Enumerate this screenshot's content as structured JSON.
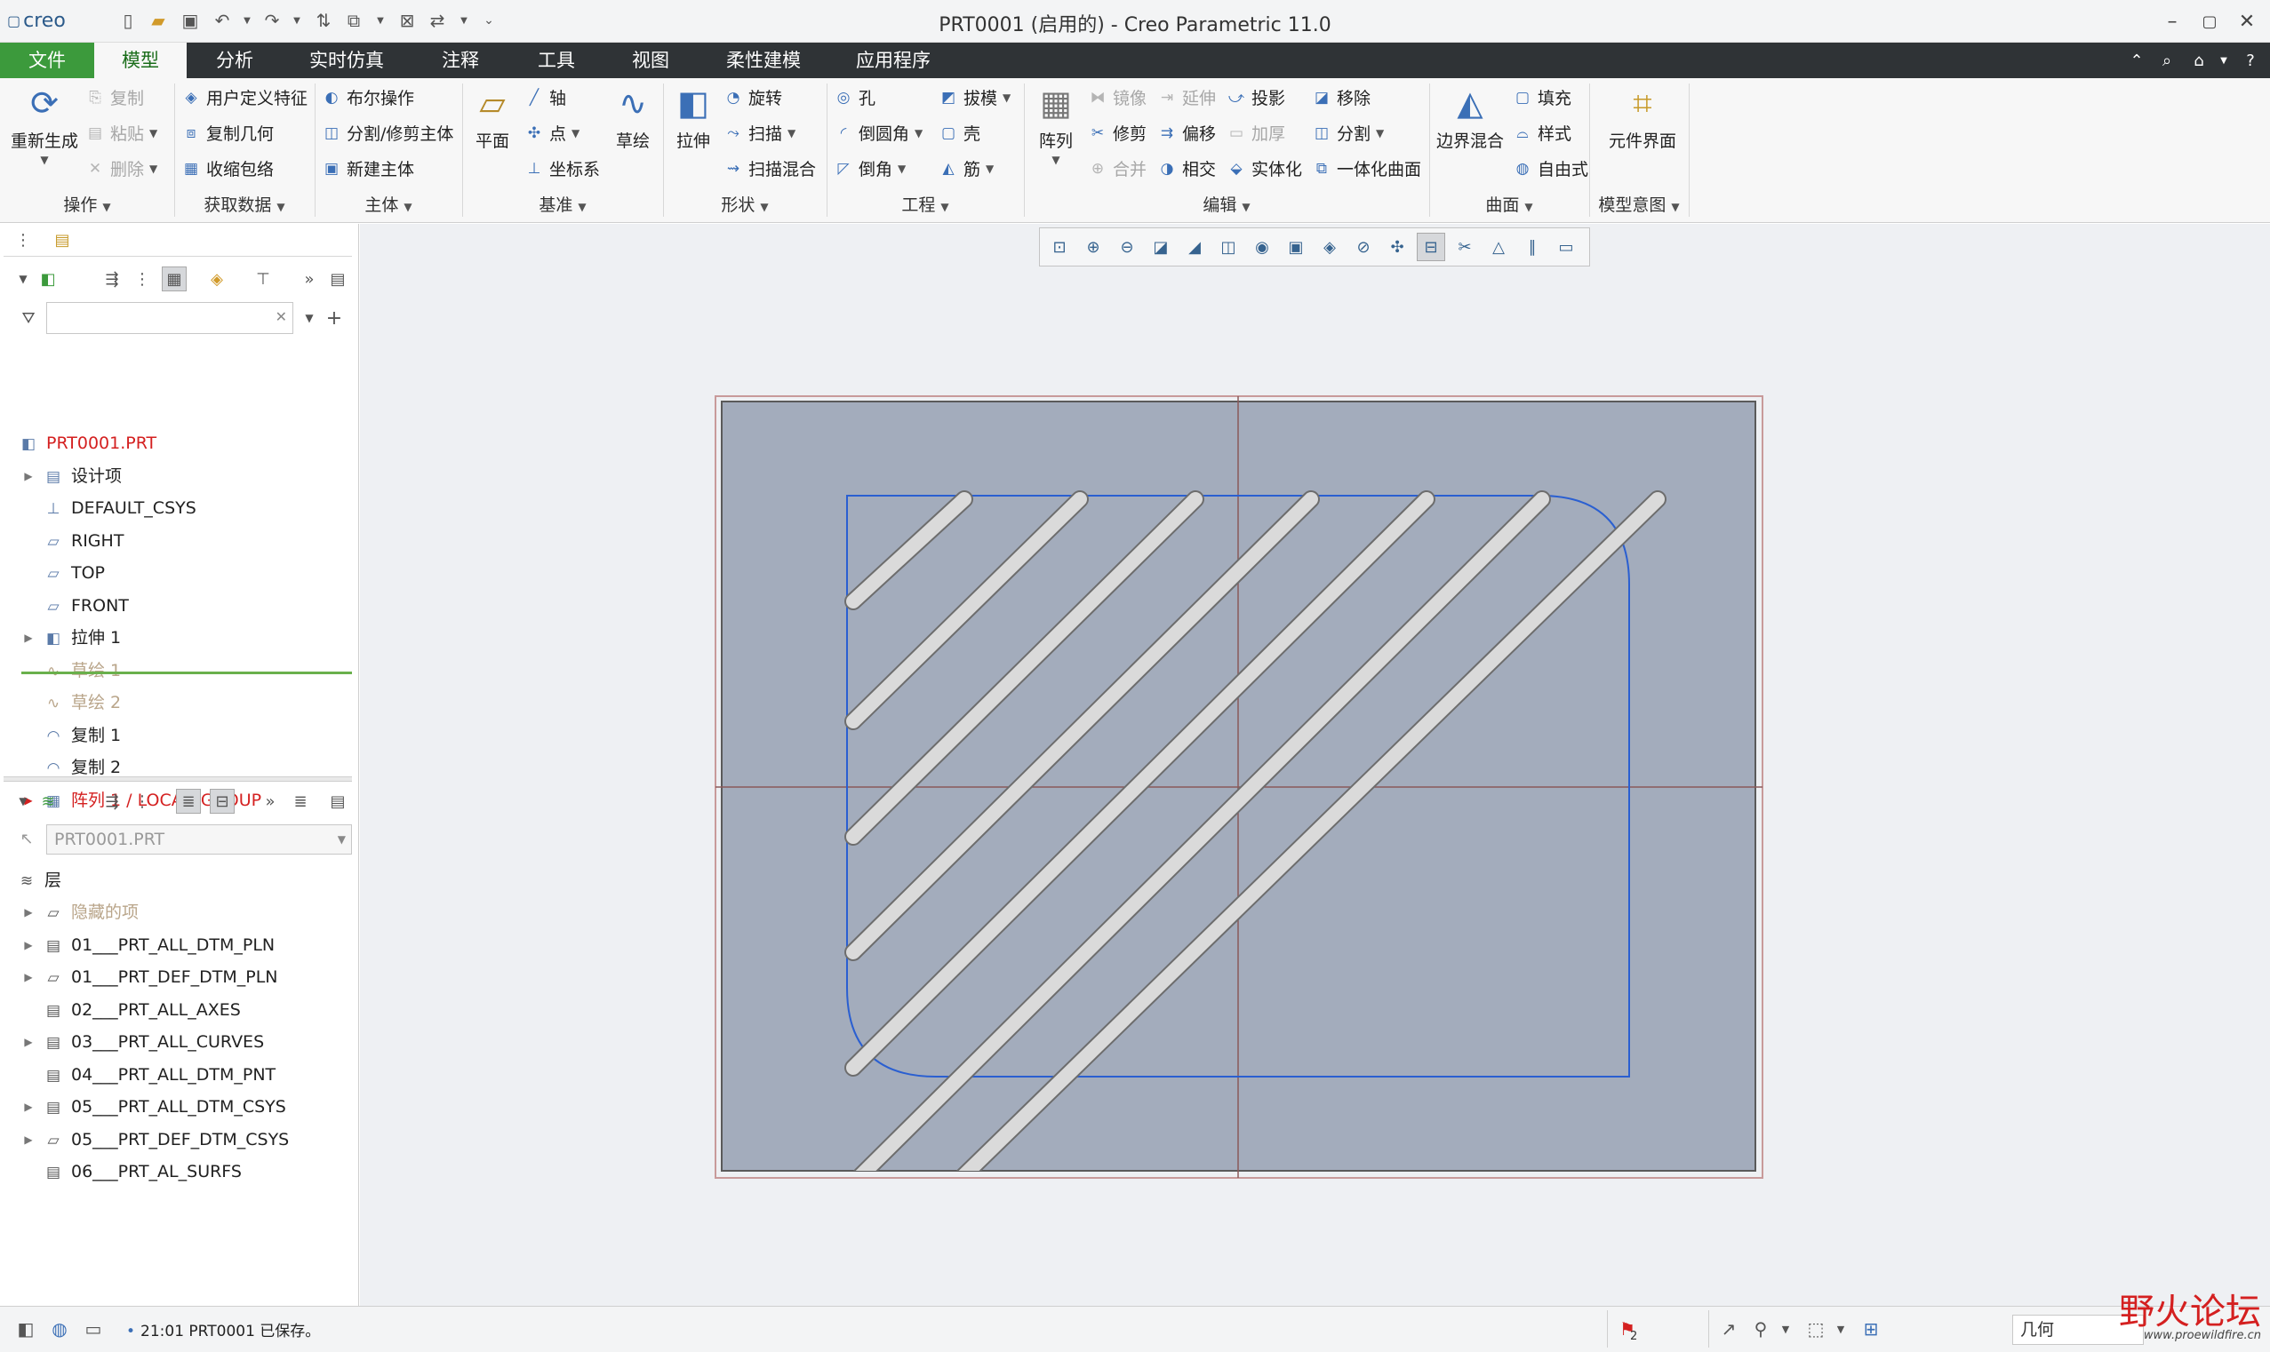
{
  "app": {
    "logo": "creo",
    "window_title": "PRT0001 (启用的) - Creo Parametric 11.0"
  },
  "menubar": {
    "tabs": [
      "文件",
      "模型",
      "分析",
      "实时仿真",
      "注释",
      "工具",
      "视图",
      "柔性建模",
      "应用程序"
    ],
    "active": "模型"
  },
  "ribbon": {
    "operations": {
      "regenerate": "重新生成",
      "copy": "复制",
      "paste": "粘贴",
      "delete": "删除",
      "group": "操作"
    },
    "get_data": {
      "udf": "用户定义特征",
      "copy_geom": "复制几何",
      "shrinkwrap": "收缩包络",
      "group": "获取数据"
    },
    "body": {
      "boolean": "布尔操作",
      "split": "分割/修剪主体",
      "new_body": "新建主体",
      "group": "主体"
    },
    "datum": {
      "plane": "平面",
      "axis": "轴",
      "point": "点",
      "csys": "坐标系",
      "sketch": "草绘",
      "group": "基准"
    },
    "shapes": {
      "extrude": "拉伸",
      "revolve": "旋转",
      "sweep": "扫描",
      "swept_blend": "扫描混合",
      "group": "形状"
    },
    "engineering": {
      "hole": "孔",
      "draft": "拔模",
      "round": "倒圆角",
      "shell": "壳",
      "chamfer": "倒角",
      "rib": "筋",
      "group": "工程"
    },
    "editing": {
      "pattern": "阵列",
      "mirror": "镜像",
      "extend": "延伸",
      "project": "投影",
      "remove": "移除",
      "trim": "修剪",
      "offset": "偏移",
      "thicken": "加厚",
      "split": "分割",
      "merge": "合并",
      "intersect": "相交",
      "solidify": "实体化",
      "unify": "一体化曲面",
      "group": "编辑"
    },
    "surfaces": {
      "boundary_blend": "边界混合",
      "fill": "填充",
      "style": "样式",
      "freestyle": "自由式",
      "group": "曲面"
    },
    "model_intent": {
      "component_interface": "元件界面",
      "group": "模型意图"
    }
  },
  "model_tree": {
    "items": [
      {
        "label": "PRT0001.PRT",
        "icon": "part-icon",
        "style": "red"
      },
      {
        "label": "设计项",
        "icon": "design-items-icon",
        "style": "normal",
        "expandable": true
      },
      {
        "label": "DEFAULT_CSYS",
        "icon": "csys-icon",
        "style": "normal"
      },
      {
        "label": "RIGHT",
        "icon": "datum-plane-icon",
        "style": "normal"
      },
      {
        "label": "TOP",
        "icon": "datum-plane-icon",
        "style": "normal"
      },
      {
        "label": "FRONT",
        "icon": "datum-plane-icon",
        "style": "normal"
      },
      {
        "label": "拉伸 1",
        "icon": "extrude-icon",
        "style": "normal",
        "expandable": true
      },
      {
        "label": "草绘 1",
        "icon": "sketch-icon",
        "style": "dim"
      },
      {
        "label": "草绘 2",
        "icon": "sketch-icon",
        "style": "dim"
      },
      {
        "label": "复制 1",
        "icon": "copy-surface-icon",
        "style": "normal"
      },
      {
        "label": "复制 2",
        "icon": "copy-surface-icon",
        "style": "normal"
      },
      {
        "label": "阵列 1 / LOCAL_GROUP",
        "icon": "pattern-icon",
        "style": "red",
        "expandable": true
      }
    ]
  },
  "layer_tree": {
    "model": "PRT0001.PRT",
    "root": "层",
    "items": [
      {
        "label": "隐藏的项",
        "style": "dim",
        "expandable": true
      },
      {
        "label": "01___PRT_ALL_DTM_PLN",
        "style": "normal",
        "expandable": true
      },
      {
        "label": "01___PRT_DEF_DTM_PLN",
        "style": "normal",
        "expandable": true
      },
      {
        "label": "02___PRT_ALL_AXES",
        "style": "normal",
        "expandable": false
      },
      {
        "label": "03___PRT_ALL_CURVES",
        "style": "normal",
        "expandable": true
      },
      {
        "label": "04___PRT_ALL_DTM_PNT",
        "style": "normal",
        "expandable": false
      },
      {
        "label": "05___PRT_ALL_DTM_CSYS",
        "style": "normal",
        "expandable": true
      },
      {
        "label": "05___PRT_DEF_DTM_CSYS",
        "style": "normal",
        "expandable": true
      },
      {
        "label": "06___PRT_AL_SURFS",
        "style": "normal",
        "expandable": false
      }
    ]
  },
  "status": {
    "message": "21:01 PRT0001 已保存。",
    "flag_count": "2",
    "filter_value": "几何"
  },
  "watermark": {
    "text": "野火论坛",
    "url": "www.proewildfire.cn"
  },
  "colors": {
    "file_tab": "#3c9a3c",
    "menubar_bg": "#2f3336",
    "part_surface": "#a3acbc",
    "sketch_curve": "#2a5fd1",
    "slot_fill": "#dadada"
  }
}
